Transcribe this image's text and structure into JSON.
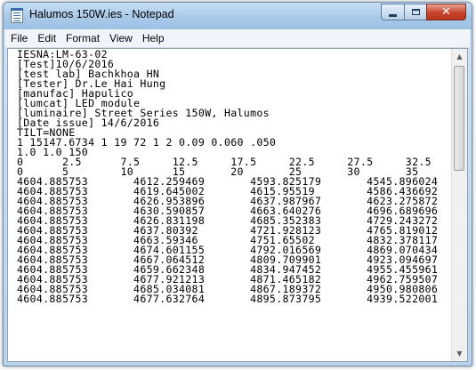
{
  "window": {
    "title": "Halumos 150W.ies - Notepad",
    "controls": {
      "minimize": "minimize",
      "maximize": "maximize",
      "close": "✕"
    }
  },
  "menu": {
    "file": "File",
    "edit": "Edit",
    "format": "Format",
    "view": "View",
    "help": "Help"
  },
  "document": {
    "lines": [
      "IESNA:LM-63-02",
      "[Test]10/6/2016",
      "[test lab] Bachkhoa HN",
      "[Tester] Dr.Le Hai Hung",
      "[manufac] Hapulico",
      "[lumcat] LED module",
      "[luminaire] Street Series 150W, Halumos",
      "[Date issue] 14/6/2016",
      "TILT=NONE",
      "1 15147.6734 1 19 72 1 2 0.09 0.060 .050",
      "1.0 1.0 150",
      "0      2.5      7.5     12.5     17.5     22.5     27.5     32.5",
      "0      5        10      15       20       25       30       35",
      "4604.885753       4612.259469       4593.825179       4545.896024",
      "4604.885753       4619.645002       4615.95519        4586.436692",
      "4604.885753       4626.953896       4637.987967       4623.275872",
      "4604.885753       4630.590857       4663.640276       4696.689696",
      "4604.885753       4626.831198       4685.352383       4729.243272",
      "4604.885753       4637.80392        4721.928123       4765.819012",
      "4604.885753       4663.59346        4751.65502        4832.378117",
      "4604.885753       4674.601155       4792.016569       4869.070434",
      "4604.885753       4667.064512       4809.709901       4923.094697",
      "4604.885753       4659.662348       4834.947452       4955.455961",
      "4604.885753       4677.921213       4871.465182       4962.759507",
      "4604.885753       4685.034081       4867.189372       4950.980806",
      "4604.885753       4677.632764       4895.873795       4939.522001"
    ]
  },
  "scrollbar": {
    "up_icon": "▲",
    "down_icon": "▼"
  }
}
